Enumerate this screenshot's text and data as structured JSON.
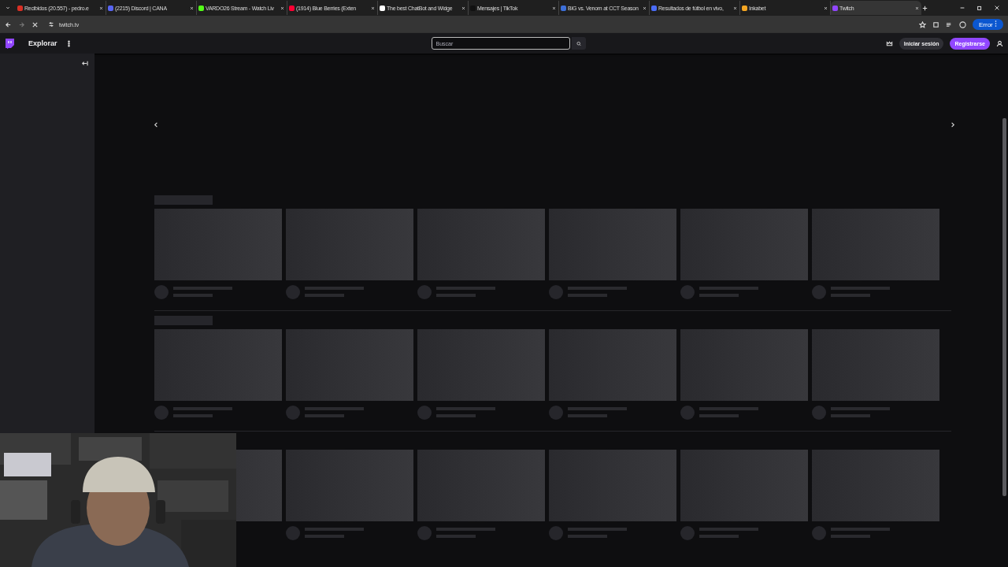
{
  "browser": {
    "tabs": [
      {
        "title": "Recibidos (20.557) - pedro.e",
        "selected": false,
        "color": "#d93025"
      },
      {
        "title": "(2215) Discord | CANA",
        "selected": false,
        "color": "#5865f2"
      },
      {
        "title": "VARDO26 Stream - Watch Liv",
        "selected": false,
        "color": "#53fc18"
      },
      {
        "title": "(1914) Blue Berries (Exten",
        "selected": false,
        "color": "#ff0033"
      },
      {
        "title": "The best ChatBot and Widge",
        "selected": false,
        "color": "#ffffff"
      },
      {
        "title": "Mensajes | TikTok",
        "selected": false,
        "color": "#111111"
      },
      {
        "title": "BIG vs. Venom at CCT Season",
        "selected": false,
        "color": "#3d6fd8"
      },
      {
        "title": "Resultados de fútbol en vivo,",
        "selected": false,
        "color": "#4a6cf7"
      },
      {
        "title": "Inkabet",
        "selected": false,
        "color": "#f5a623"
      },
      {
        "title": "Twitch",
        "selected": true,
        "color": "#9146ff"
      }
    ],
    "address": "twitch.tv",
    "profile_label": "Error"
  },
  "twitch": {
    "explore": "Explorar",
    "search": {
      "placeholder": "Buscar"
    },
    "login": "Iniciar sesión",
    "signup": "Registrarse"
  }
}
